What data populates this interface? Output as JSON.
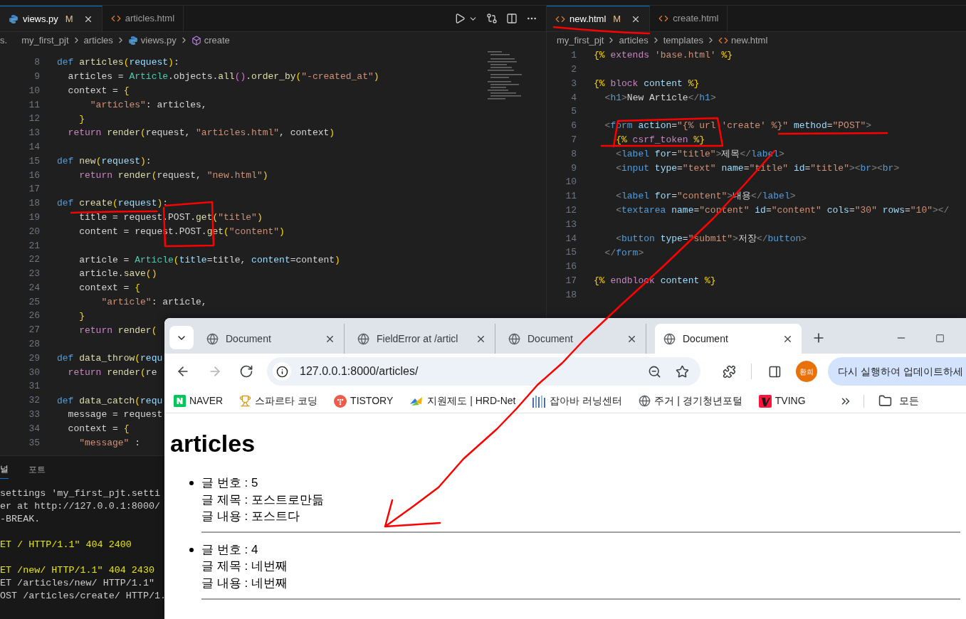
{
  "editor_left": {
    "tabs": [
      {
        "kind": "python",
        "label": "views.py",
        "status": "M",
        "selected": true
      },
      {
        "kind": "html",
        "label": "articles.html",
        "selected": false
      }
    ],
    "breadcrumb_cut": "s.",
    "breadcrumb": [
      {
        "kind": "folder",
        "text": "my_first_pjt"
      },
      {
        "kind": "folder",
        "text": "articles"
      },
      {
        "kind": "python",
        "text": "views.py"
      },
      {
        "kind": "symbol",
        "text": "create"
      }
    ],
    "lines": [
      {
        "number": "8",
        "tokens": [
          {
            "kind": "keyword",
            "text": "def "
          },
          {
            "kind": "function",
            "text": "articles"
          },
          {
            "kind": "bracket",
            "text": "("
          },
          {
            "kind": "parameter",
            "text": "request"
          },
          {
            "kind": "bracket",
            "text": ")"
          },
          {
            "kind": "plain",
            "text": ":"
          }
        ]
      },
      {
        "number": "9",
        "tokens": [
          {
            "kind": "plain",
            "text": "  articles = "
          },
          {
            "kind": "class",
            "text": "Article"
          },
          {
            "kind": "plain",
            "text": ".objects."
          },
          {
            "kind": "function",
            "text": "all"
          },
          {
            "kind": "bracket2",
            "text": "()"
          },
          {
            "kind": "plain",
            "text": "."
          },
          {
            "kind": "function",
            "text": "order_by"
          },
          {
            "kind": "bracket",
            "text": "("
          },
          {
            "kind": "string",
            "text": "\"-created_at\""
          },
          {
            "kind": "bracket",
            "text": ")"
          }
        ]
      },
      {
        "number": "10",
        "tokens": [
          {
            "kind": "plain",
            "text": "  context = "
          },
          {
            "kind": "bracket",
            "text": "{"
          }
        ]
      },
      {
        "number": "11",
        "tokens": [
          {
            "kind": "string",
            "text": "      \"articles\""
          },
          {
            "kind": "plain",
            "text": ": articles,"
          }
        ]
      },
      {
        "number": "12",
        "tokens": [
          {
            "kind": "bracket",
            "text": "    }"
          }
        ]
      },
      {
        "number": "13",
        "tokens": [
          {
            "kind": "control",
            "text": "  return "
          },
          {
            "kind": "function",
            "text": "render"
          },
          {
            "kind": "bracket",
            "text": "("
          },
          {
            "kind": "plain",
            "text": "request, "
          },
          {
            "kind": "string",
            "text": "\"articles.html\""
          },
          {
            "kind": "plain",
            "text": ", context"
          },
          {
            "kind": "bracket",
            "text": ")"
          }
        ]
      },
      {
        "number": "14"
      },
      {
        "number": "15",
        "tokens": [
          {
            "kind": "keyword",
            "text": "def "
          },
          {
            "kind": "function",
            "text": "new"
          },
          {
            "kind": "bracket",
            "text": "("
          },
          {
            "kind": "parameter",
            "text": "request"
          },
          {
            "kind": "bracket",
            "text": ")"
          },
          {
            "kind": "plain",
            "text": ":"
          }
        ]
      },
      {
        "number": "16",
        "tokens": [
          {
            "kind": "control",
            "text": "    return "
          },
          {
            "kind": "function",
            "text": "render"
          },
          {
            "kind": "bracket",
            "text": "("
          },
          {
            "kind": "plain",
            "text": "request, "
          },
          {
            "kind": "string",
            "text": "\"new.html\""
          },
          {
            "kind": "bracket",
            "text": ")"
          }
        ]
      },
      {
        "number": "17"
      },
      {
        "number": "18",
        "tokens": [
          {
            "kind": "keyword",
            "text": "def "
          },
          {
            "kind": "function",
            "text": "create"
          },
          {
            "kind": "bracket",
            "text": "("
          },
          {
            "kind": "parameter",
            "text": "request"
          },
          {
            "kind": "bracket",
            "text": ")"
          },
          {
            "kind": "plain",
            "text": ":"
          }
        ]
      },
      {
        "number": "19",
        "tokens": [
          {
            "kind": "plain",
            "text": "    title = request.POST."
          },
          {
            "kind": "function",
            "text": "get"
          },
          {
            "kind": "bracket",
            "text": "("
          },
          {
            "kind": "string",
            "text": "\"title\""
          },
          {
            "kind": "bracket",
            "text": ")"
          }
        ]
      },
      {
        "number": "20",
        "tokens": [
          {
            "kind": "plain",
            "text": "    content = request.POST."
          },
          {
            "kind": "function",
            "text": "get"
          },
          {
            "kind": "bracket",
            "text": "("
          },
          {
            "kind": "string",
            "text": "\"content\""
          },
          {
            "kind": "bracket",
            "text": ")"
          }
        ]
      },
      {
        "number": "21"
      },
      {
        "number": "22",
        "tokens": [
          {
            "kind": "plain",
            "text": "    article = "
          },
          {
            "kind": "class",
            "text": "Article"
          },
          {
            "kind": "bracket",
            "text": "("
          },
          {
            "kind": "parameter",
            "text": "title"
          },
          {
            "kind": "plain",
            "text": "=title, "
          },
          {
            "kind": "parameter",
            "text": "content"
          },
          {
            "kind": "plain",
            "text": "=content"
          },
          {
            "kind": "bracket",
            "text": ")"
          }
        ]
      },
      {
        "number": "23",
        "tokens": [
          {
            "kind": "plain",
            "text": "    article."
          },
          {
            "kind": "function",
            "text": "save"
          },
          {
            "kind": "bracket",
            "text": "()"
          }
        ]
      },
      {
        "number": "24",
        "tokens": [
          {
            "kind": "plain",
            "text": "    context = "
          },
          {
            "kind": "bracket",
            "text": "{"
          }
        ]
      },
      {
        "number": "25",
        "tokens": [
          {
            "kind": "string",
            "text": "        \"article\""
          },
          {
            "kind": "plain",
            "text": ": article,"
          }
        ]
      },
      {
        "number": "26",
        "tokens": [
          {
            "kind": "bracket",
            "text": "    }"
          }
        ]
      },
      {
        "number": "27",
        "tokens": [
          {
            "kind": "control",
            "text": "    return "
          },
          {
            "kind": "function",
            "text": "render"
          },
          {
            "kind": "bracket",
            "text": "("
          }
        ]
      },
      {
        "number": "28"
      },
      {
        "number": "29",
        "tokens": [
          {
            "kind": "keyword",
            "text": "def "
          },
          {
            "kind": "function",
            "text": "data_throw"
          },
          {
            "kind": "bracket",
            "text": "("
          },
          {
            "kind": "parameter",
            "text": "requ"
          }
        ]
      },
      {
        "number": "30",
        "tokens": [
          {
            "kind": "control",
            "text": "  return "
          },
          {
            "kind": "function",
            "text": "render"
          },
          {
            "kind": "bracket",
            "text": "("
          },
          {
            "kind": "plain",
            "text": "re"
          }
        ]
      },
      {
        "number": "31"
      },
      {
        "number": "32",
        "tokens": [
          {
            "kind": "keyword",
            "text": "def "
          },
          {
            "kind": "function",
            "text": "data_catch"
          },
          {
            "kind": "bracket",
            "text": "("
          },
          {
            "kind": "parameter",
            "text": "requ"
          }
        ]
      },
      {
        "number": "33",
        "tokens": [
          {
            "kind": "plain",
            "text": "  message = request"
          }
        ]
      },
      {
        "number": "34",
        "tokens": [
          {
            "kind": "plain",
            "text": "  context = "
          },
          {
            "kind": "bracket",
            "text": "{"
          }
        ]
      },
      {
        "number": "35",
        "tokens": [
          {
            "kind": "string",
            "text": "    \"message\""
          },
          {
            "kind": "plain",
            "text": " :"
          }
        ]
      }
    ]
  },
  "terminal": {
    "tabs": [
      {
        "label": "널",
        "selected": true
      },
      {
        "label": "포트",
        "selected": false
      }
    ],
    "blocks": [
      [
        {
          "kind": "normal",
          "text": "settings 'my_first_pjt.setti"
        },
        {
          "kind": "normal",
          "text": "er at http://127.0.0.1:8000/"
        },
        {
          "kind": "normal",
          "text": "-BREAK."
        }
      ],
      [
        {
          "kind": "warning",
          "text": "ET / HTTP/1.1\" 404 2400"
        }
      ],
      [
        {
          "kind": "warning",
          "text": "ET /new/ HTTP/1.1\" 404 2430"
        },
        {
          "kind": "normal",
          "text": "ET /articles/new/ HTTP/1.1\""
        },
        {
          "kind": "normal",
          "text": "OST /articles/create/ HTTP/1."
        }
      ]
    ]
  },
  "editor_right": {
    "tabs": [
      {
        "kind": "html",
        "label": "new.html",
        "status": "M",
        "selected": true
      },
      {
        "kind": "html",
        "label": "create.html",
        "selected": false
      }
    ],
    "breadcrumb": [
      {
        "kind": "folder",
        "text": "my_first_pjt"
      },
      {
        "kind": "folder",
        "text": "articles"
      },
      {
        "kind": "folder",
        "text": "templates"
      },
      {
        "kind": "html",
        "text": "new.html"
      }
    ],
    "lines": [
      {
        "number": "1",
        "tokens": [
          {
            "kind": "template",
            "text": "{% "
          },
          {
            "kind": "control",
            "text": "extends "
          },
          {
            "kind": "string",
            "text": "'base.html' "
          },
          {
            "kind": "template",
            "text": "%}"
          }
        ]
      },
      {
        "number": "2"
      },
      {
        "number": "3",
        "tokens": [
          {
            "kind": "template",
            "text": "{% "
          },
          {
            "kind": "control",
            "text": "block "
          },
          {
            "kind": "parameter",
            "text": "content "
          },
          {
            "kind": "template",
            "text": "%}"
          }
        ]
      },
      {
        "number": "4",
        "tokens": [
          {
            "kind": "punctuation",
            "text": "  <"
          },
          {
            "kind": "tag",
            "text": "h1"
          },
          {
            "kind": "punctuation",
            "text": ">"
          },
          {
            "kind": "plain",
            "text": "New Article"
          },
          {
            "kind": "punctuation",
            "text": "</"
          },
          {
            "kind": "tag",
            "text": "h1"
          },
          {
            "kind": "punctuation",
            "text": ">"
          }
        ]
      },
      {
        "number": "5"
      },
      {
        "number": "6",
        "tokens": [
          {
            "kind": "punctuation",
            "text": "  <"
          },
          {
            "kind": "tag",
            "text": "form "
          },
          {
            "kind": "attribute",
            "text": "action"
          },
          {
            "kind": "plain",
            "text": "="
          },
          {
            "kind": "string",
            "text": "\"{% url 'create' %}\" "
          },
          {
            "kind": "attribute",
            "text": "method"
          },
          {
            "kind": "plain",
            "text": "="
          },
          {
            "kind": "string",
            "text": "\"POST\""
          },
          {
            "kind": "punctuation",
            "text": ">"
          }
        ]
      },
      {
        "number": "7",
        "tokens": [
          {
            "kind": "template",
            "text": "    {% "
          },
          {
            "kind": "control",
            "text": "csrf_token "
          },
          {
            "kind": "template",
            "text": "%}"
          }
        ]
      },
      {
        "number": "8",
        "tokens": [
          {
            "kind": "punctuation",
            "text": "    <"
          },
          {
            "kind": "tag",
            "text": "label "
          },
          {
            "kind": "attribute",
            "text": "for"
          },
          {
            "kind": "plain",
            "text": "="
          },
          {
            "kind": "string",
            "text": "\"title\""
          },
          {
            "kind": "punctuation",
            "text": ">"
          },
          {
            "kind": "plain",
            "text": "제목"
          },
          {
            "kind": "punctuation",
            "text": "</"
          },
          {
            "kind": "tag",
            "text": "label"
          },
          {
            "kind": "punctuation",
            "text": ">"
          }
        ]
      },
      {
        "number": "9",
        "tokens": [
          {
            "kind": "punctuation",
            "text": "    <"
          },
          {
            "kind": "tag",
            "text": "input "
          },
          {
            "kind": "attribute",
            "text": "type"
          },
          {
            "kind": "plain",
            "text": "="
          },
          {
            "kind": "string",
            "text": "\"text\" "
          },
          {
            "kind": "attribute",
            "text": "name"
          },
          {
            "kind": "plain",
            "text": "="
          },
          {
            "kind": "string",
            "text": "\"title\" "
          },
          {
            "kind": "attribute",
            "text": "id"
          },
          {
            "kind": "plain",
            "text": "="
          },
          {
            "kind": "string",
            "text": "\"title\""
          },
          {
            "kind": "punctuation",
            "text": "><"
          },
          {
            "kind": "tag",
            "text": "br"
          },
          {
            "kind": "punctuation",
            "text": "><"
          },
          {
            "kind": "tag",
            "text": "br"
          },
          {
            "kind": "punctuation",
            "text": ">"
          }
        ]
      },
      {
        "number": "10"
      },
      {
        "number": "11",
        "tokens": [
          {
            "kind": "punctuation",
            "text": "    <"
          },
          {
            "kind": "tag",
            "text": "label "
          },
          {
            "kind": "attribute",
            "text": "for"
          },
          {
            "kind": "plain",
            "text": "="
          },
          {
            "kind": "string",
            "text": "\"content\""
          },
          {
            "kind": "punctuation",
            "text": ">"
          },
          {
            "kind": "plain",
            "text": "내용"
          },
          {
            "kind": "punctuation",
            "text": "</"
          },
          {
            "kind": "tag",
            "text": "label"
          },
          {
            "kind": "punctuation",
            "text": ">"
          }
        ]
      },
      {
        "number": "12",
        "tokens": [
          {
            "kind": "punctuation",
            "text": "    <"
          },
          {
            "kind": "tag",
            "text": "textarea "
          },
          {
            "kind": "attribute",
            "text": "name"
          },
          {
            "kind": "plain",
            "text": "="
          },
          {
            "kind": "string",
            "text": "\"content\" "
          },
          {
            "kind": "attribute",
            "text": "id"
          },
          {
            "kind": "plain",
            "text": "="
          },
          {
            "kind": "string",
            "text": "\"content\" "
          },
          {
            "kind": "attribute",
            "text": "cols"
          },
          {
            "kind": "plain",
            "text": "="
          },
          {
            "kind": "string",
            "text": "\"30\" "
          },
          {
            "kind": "attribute",
            "text": "rows"
          },
          {
            "kind": "plain",
            "text": "="
          },
          {
            "kind": "string",
            "text": "\"10\""
          },
          {
            "kind": "punctuation",
            "text": "></"
          }
        ]
      },
      {
        "number": "13"
      },
      {
        "number": "14",
        "tokens": [
          {
            "kind": "punctuation",
            "text": "    <"
          },
          {
            "kind": "tag",
            "text": "button "
          },
          {
            "kind": "attribute",
            "text": "type"
          },
          {
            "kind": "plain",
            "text": "="
          },
          {
            "kind": "string",
            "text": "\"submit\""
          },
          {
            "kind": "punctuation",
            "text": ">"
          },
          {
            "kind": "plain",
            "text": "저장"
          },
          {
            "kind": "punctuation",
            "text": "</"
          },
          {
            "kind": "tag",
            "text": "button"
          },
          {
            "kind": "punctuation",
            "text": ">"
          }
        ]
      },
      {
        "number": "15",
        "tokens": [
          {
            "kind": "punctuation",
            "text": "  </"
          },
          {
            "kind": "tag",
            "text": "form"
          },
          {
            "kind": "punctuation",
            "text": ">"
          }
        ]
      },
      {
        "number": "16"
      },
      {
        "number": "17",
        "tokens": [
          {
            "kind": "template",
            "text": "{% "
          },
          {
            "kind": "control",
            "text": "endblock "
          },
          {
            "kind": "parameter",
            "text": "content "
          },
          {
            "kind": "template",
            "text": "%}"
          }
        ]
      },
      {
        "number": "18"
      }
    ]
  },
  "browser": {
    "tabs": [
      {
        "title": "Document",
        "selected": false
      },
      {
        "title": "FieldError at /articl",
        "selected": false
      },
      {
        "title": "Document",
        "selected": false
      },
      {
        "title": "Document",
        "selected": true
      }
    ],
    "nav_buttons": [
      {
        "kind": "back",
        "disabled": false
      },
      {
        "kind": "forward",
        "disabled": true
      },
      {
        "kind": "reload",
        "disabled": false
      }
    ],
    "url": "127.0.0.1:8000/articles/",
    "profile": "환희",
    "update_button": "다시 실행하여 업데이트하세",
    "bookmarks": [
      {
        "kind": "naver",
        "label": "NAVER"
      },
      {
        "kind": "trophy",
        "label": "스파르타 코딩"
      },
      {
        "kind": "dots",
        "label": "TISTORY"
      },
      {
        "kind": "hrd",
        "label": "지원제도 | HRD-Net"
      },
      {
        "kind": "bars",
        "label": "잡아바 러닝센터"
      },
      {
        "kind": "globe",
        "label": "주거 | 경기청년포털"
      },
      {
        "kind": "tving",
        "label": "TVING"
      }
    ],
    "folder": "모든",
    "page": {
      "heading": "articles",
      "articles": [
        {
          "lines": [
            "글 번호 : 5",
            "글 제목 : 포스트로만듦",
            "글 내용 : 포스트다"
          ]
        },
        {
          "lines": [
            "글 번호 : 4",
            "글 제목 : 네번째",
            "글 내용 : 네번째"
          ]
        }
      ]
    }
  }
}
